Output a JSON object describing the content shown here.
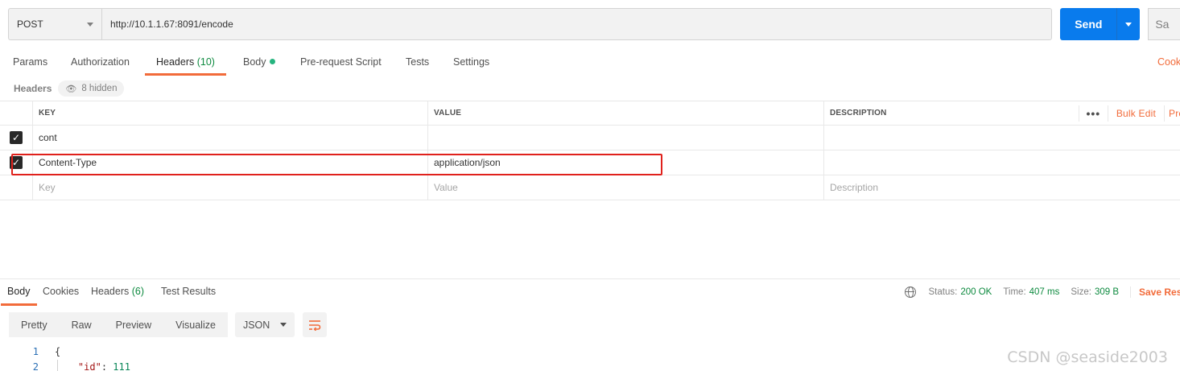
{
  "request": {
    "method": "POST",
    "url": "http://10.1.1.67:8091/encode",
    "send_label": "Send",
    "save_label": "Sa"
  },
  "tabs": {
    "params": "Params",
    "authorization": "Authorization",
    "headers": "Headers",
    "headers_count": "(10)",
    "body": "Body",
    "prerequest": "Pre-request Script",
    "tests": "Tests",
    "settings": "Settings",
    "cookies": "Cook"
  },
  "headers_section": {
    "label": "Headers",
    "hidden_text": "8 hidden"
  },
  "table": {
    "columns": {
      "key": "KEY",
      "value": "VALUE",
      "description": "DESCRIPTION"
    },
    "more": "•••",
    "bulk_edit": "Bulk Edit",
    "presets": "Pre",
    "rows": [
      {
        "checked": true,
        "key": "cont",
        "value": "",
        "description": ""
      },
      {
        "checked": true,
        "key": "Content-Type",
        "value": "application/json",
        "description": ""
      }
    ],
    "placeholder": {
      "key": "Key",
      "value": "Value",
      "description": "Description"
    }
  },
  "response": {
    "tabs": {
      "body": "Body",
      "cookies": "Cookies",
      "headers": "Headers",
      "headers_count": "(6)",
      "test_results": "Test Results"
    },
    "status_label": "Status:",
    "status_value": "200 OK",
    "time_label": "Time:",
    "time_value": "407 ms",
    "size_label": "Size:",
    "size_value": "309 B",
    "save_response": "Save Res",
    "views": [
      "Pretty",
      "Raw",
      "Preview",
      "Visualize"
    ],
    "format": "JSON",
    "code": {
      "line1_no": "1",
      "line1": "{",
      "line2_no": "2",
      "line2_key": "\"id\"",
      "line2_sep": ": ",
      "line2_val": "111"
    }
  },
  "watermark": "CSDN @seaside2003",
  "colors": {
    "accent": "#f26b3a",
    "send_blue": "#097bed",
    "status_green": "#0d8a3f",
    "highlight_red": "#e0211c"
  }
}
